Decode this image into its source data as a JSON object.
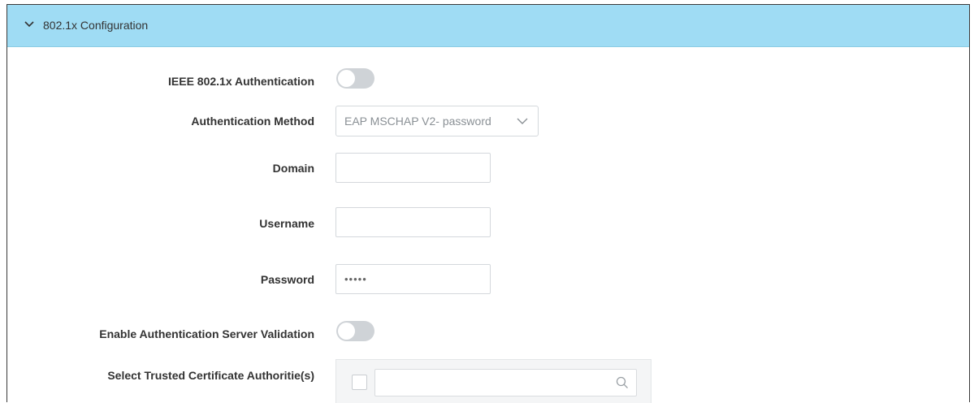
{
  "header": {
    "title": "802.1x Configuration",
    "chevron_icon": "chevron-down-icon"
  },
  "form": {
    "ieee_auth": {
      "label": "IEEE 802.1x Authentication",
      "enabled": false
    },
    "auth_method": {
      "label": "Authentication Method",
      "value": "EAP MSCHAP V2- password",
      "icon": "chevron-down-icon"
    },
    "domain": {
      "label": "Domain",
      "value": ""
    },
    "username": {
      "label": "Username",
      "value": ""
    },
    "password": {
      "label": "Password",
      "value": "•••••"
    },
    "server_validation": {
      "label": "Enable Authentication Server Validation",
      "enabled": false
    },
    "trusted_ca": {
      "label": "Select Trusted Certificate Authoritie(s)",
      "search_value": "",
      "checked": false,
      "icon": "search-icon"
    }
  },
  "colors": {
    "header_bg": "#9fdcf4",
    "toggle_off": "#cfd3d7",
    "border": "#d4d8dc"
  }
}
